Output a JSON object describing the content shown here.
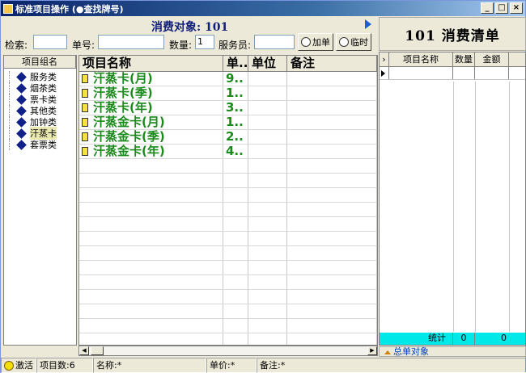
{
  "window": {
    "title": "标准项目操作 (●查找牌号)"
  },
  "top": {
    "object_label": "消费对象: 101"
  },
  "search": {
    "search_label": "检索:",
    "search_value": "",
    "order_label": "单号:",
    "order_value": "",
    "qty_label": "数量:",
    "qty_value": "1",
    "waiter_label": "服务员:",
    "waiter_value": "",
    "add_button": "加单",
    "temp_button": "临时"
  },
  "right_header": {
    "title": "101  消费清单"
  },
  "groups": {
    "header": "项目组名",
    "items": [
      {
        "label": "服务类"
      },
      {
        "label": "烟茶类"
      },
      {
        "label": "票卡类"
      },
      {
        "label": "其他类"
      },
      {
        "label": "加钟类"
      },
      {
        "label": "汗蒸卡"
      },
      {
        "label": "套票类"
      }
    ]
  },
  "list": {
    "headers": [
      "项目名称",
      "单..",
      "单位",
      "备注"
    ],
    "rows": [
      {
        "name": "汗蒸卡(月)",
        "price": "9..",
        "unit": "",
        "note": ""
      },
      {
        "name": "汗蒸卡(季)",
        "price": "1..",
        "unit": "",
        "note": ""
      },
      {
        "name": "汗蒸卡(年)",
        "price": "3..",
        "unit": "",
        "note": ""
      },
      {
        "name": "汗蒸金卡(月)",
        "price": "1..",
        "unit": "",
        "note": ""
      },
      {
        "name": "汗蒸金卡(季)",
        "price": "2..",
        "unit": "",
        "note": ""
      },
      {
        "name": "汗蒸金卡(年)",
        "price": "4..",
        "unit": "",
        "note": ""
      }
    ]
  },
  "consume": {
    "headers": [
      "项目名称",
      "数量",
      "金额"
    ],
    "sum_label": "统计",
    "sum_qty": "0",
    "sum_amount": "0",
    "total_link": "总单对象"
  },
  "status": {
    "activate": "激活",
    "count": "项目数:6",
    "name": "名称:*",
    "price": "单价:*",
    "note": "备注:*"
  }
}
